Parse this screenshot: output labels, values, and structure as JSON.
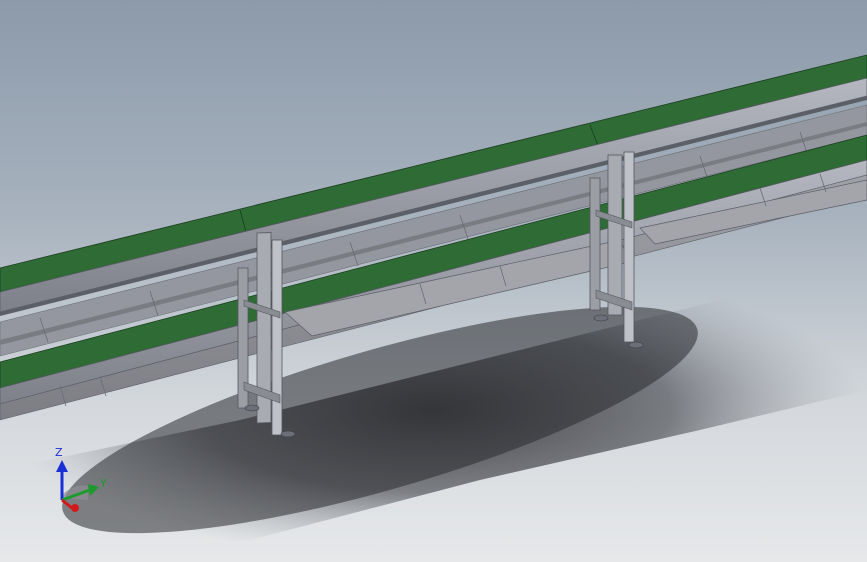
{
  "triad": {
    "z_label": "Z",
    "y_label": "Y"
  },
  "colors": {
    "background_top": "#8c9aaa",
    "background_bottom": "#e6e8ea",
    "belt": "#2f6b34",
    "belt_edge": "#1f4a23",
    "frame": "#9c9ea8",
    "frame_dark": "#6d6f78",
    "tray": "#8e9096",
    "leg": "#a6a8ae",
    "axis_z": "#1a2fd6",
    "axis_y": "#1d9a2e",
    "axis_x": "#d11a1a"
  }
}
